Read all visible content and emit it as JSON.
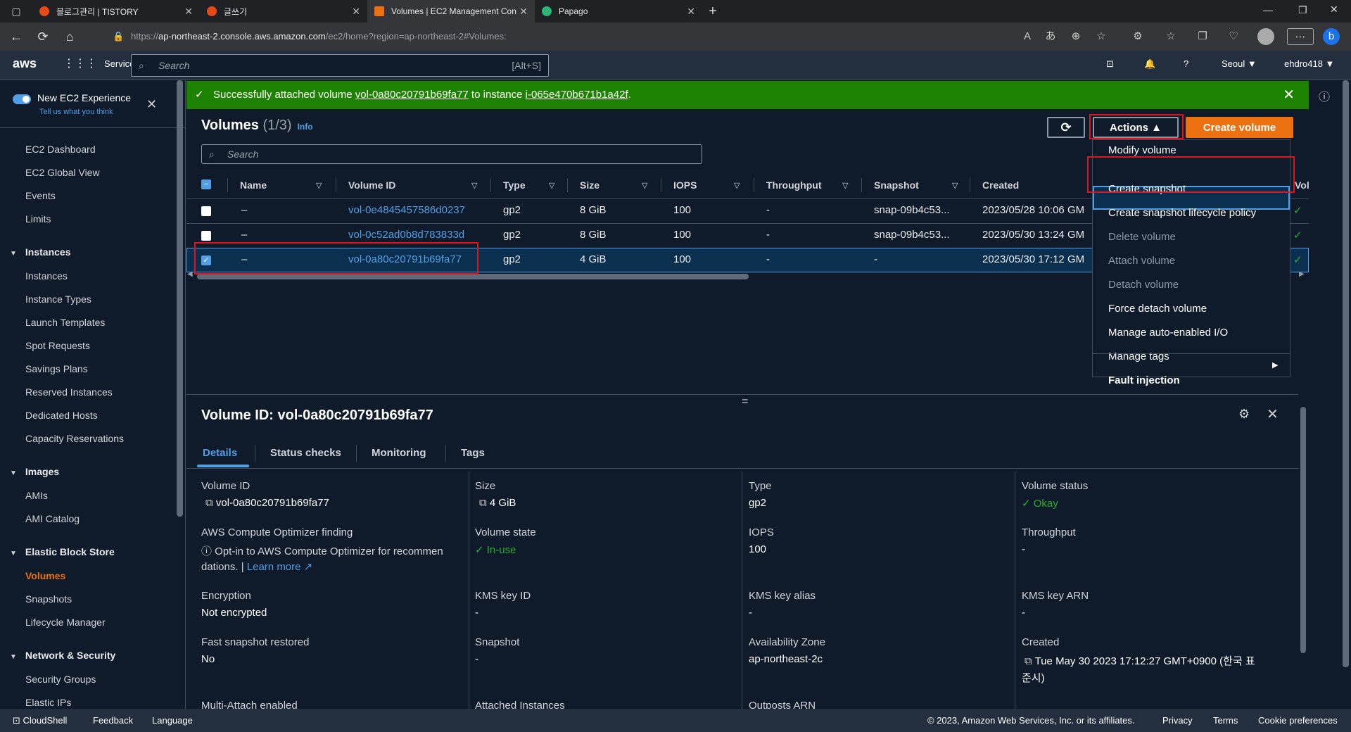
{
  "browser": {
    "tabs": [
      {
        "title": "블로그관리 | TISTORY"
      },
      {
        "title": "글쓰기"
      },
      {
        "title": "Volumes | EC2 Management Con"
      },
      {
        "title": "Papago"
      }
    ],
    "url_prefix": "https://",
    "url_host": "ap-northeast-2.console.aws.amazon.com",
    "url_path": "/ec2/home?region=ap-northeast-2#Volumes:"
  },
  "aws_nav": {
    "logo": "aws",
    "services": "Services",
    "search_placeholder": "Search",
    "search_hint": "[Alt+S]",
    "region": "Seoul ▼",
    "user": "ehdro418 ▼"
  },
  "sidebar": {
    "new_exp_title": "New EC2 Experience",
    "new_exp_sub": "Tell us what you think",
    "top_items": [
      "EC2 Dashboard",
      "EC2 Global View",
      "Events",
      "Limits"
    ],
    "sections": [
      {
        "title": "Instances",
        "items": [
          "Instances",
          "Instance Types",
          "Launch Templates",
          "Spot Requests",
          "Savings Plans",
          "Reserved Instances",
          "Dedicated Hosts",
          "Capacity Reservations"
        ]
      },
      {
        "title": "Images",
        "items": [
          "AMIs",
          "AMI Catalog"
        ]
      },
      {
        "title": "Elastic Block Store",
        "items": [
          "Volumes",
          "Snapshots",
          "Lifecycle Manager"
        ]
      },
      {
        "title": "Network & Security",
        "items": [
          "Security Groups",
          "Elastic IPs"
        ]
      }
    ]
  },
  "flash": {
    "text_prefix": "Successfully attached volume ",
    "volume_link": "vol-0a80c20791b69fa77",
    "text_mid": " to instance ",
    "instance_link": "i-065e470b671b1a42f",
    "text_suffix": "."
  },
  "volumes": {
    "title": "Volumes",
    "count": "(1/3)",
    "info": "Info",
    "search_placeholder": "Search",
    "actions_label": "Actions ▲",
    "create_label": "Create volume",
    "columns": [
      "Name",
      "Volume ID",
      "Type",
      "Size",
      "IOPS",
      "Throughput",
      "Snapshot",
      "Created",
      "Vol"
    ],
    "rows": [
      {
        "name": "–",
        "id": "vol-0e4845457586d0237",
        "type": "gp2",
        "size": "8 GiB",
        "iops": "100",
        "throughput": "-",
        "snapshot": "snap-09b4c53...",
        "created": "2023/05/28 10:06 GM"
      },
      {
        "name": "–",
        "id": "vol-0c52ad0b8d783833d",
        "type": "gp2",
        "size": "8 GiB",
        "iops": "100",
        "throughput": "-",
        "snapshot": "snap-09b4c53...",
        "created": "2023/05/30 13:24 GM"
      },
      {
        "name": "–",
        "id": "vol-0a80c20791b69fa77",
        "type": "gp2",
        "size": "4 GiB",
        "iops": "100",
        "throughput": "-",
        "snapshot": "-",
        "created": "2023/05/30 17:12 GM"
      }
    ]
  },
  "actions_menu": {
    "items": [
      {
        "label": "Modify volume",
        "enabled": true
      },
      {
        "label": "Create snapshot",
        "enabled": true
      },
      {
        "label": "Create snapshot lifecycle policy",
        "enabled": true
      },
      {
        "label": "Delete volume",
        "enabled": false
      },
      {
        "label": "Attach volume",
        "enabled": false
      },
      {
        "label": "Detach volume",
        "enabled": false
      },
      {
        "label": "Force detach volume",
        "enabled": true
      },
      {
        "label": "Manage auto-enabled I/O",
        "enabled": true
      },
      {
        "label": "Manage tags",
        "enabled": true
      },
      {
        "label": "Fault injection",
        "enabled": true
      }
    ]
  },
  "details": {
    "title": "Volume ID: vol-0a80c20791b69fa77",
    "tabs": [
      "Details",
      "Status checks",
      "Monitoring",
      "Tags"
    ],
    "fields": {
      "volume_id_label": "Volume ID",
      "volume_id": "vol-0a80c20791b69fa77",
      "size_label": "Size",
      "size": "4 GiB",
      "type_label": "Type",
      "type": "gp2",
      "status_label": "Volume status",
      "status": "Okay",
      "optimizer_label": "AWS Compute Optimizer finding",
      "optimizer_text1": "Opt-in to AWS Compute Optimizer for recommen",
      "optimizer_text2": "dations. |",
      "learn_more": "Learn more",
      "state_label": "Volume state",
      "state": "In-use",
      "iops_label": "IOPS",
      "iops": "100",
      "throughput_label": "Throughput",
      "throughput": "-",
      "encryption_label": "Encryption",
      "encryption": "Not encrypted",
      "kms_id_label": "KMS key ID",
      "kms_id": "-",
      "kms_alias_label": "KMS key alias",
      "kms_alias": "-",
      "kms_arn_label": "KMS key ARN",
      "kms_arn": "-",
      "fast_label": "Fast snapshot restored",
      "fast": "No",
      "snapshot_label": "Snapshot",
      "snapshot": "-",
      "az_label": "Availability Zone",
      "az": "ap-northeast-2c",
      "created_label": "Created",
      "created1": "Tue May 30 2023 17:12:27 GMT+0900 (한국 표",
      "created2": "준시)",
      "multi_label": "Multi-Attach enabled",
      "attached_label": "Attached Instances",
      "outposts_label": "Outposts ARN"
    }
  },
  "footer": {
    "cloudshell": "CloudShell",
    "feedback": "Feedback",
    "language": "Language",
    "copyright": "© 2023, Amazon Web Services, Inc. or its affiliates.",
    "privacy": "Privacy",
    "terms": "Terms",
    "cookie": "Cookie preferences"
  }
}
